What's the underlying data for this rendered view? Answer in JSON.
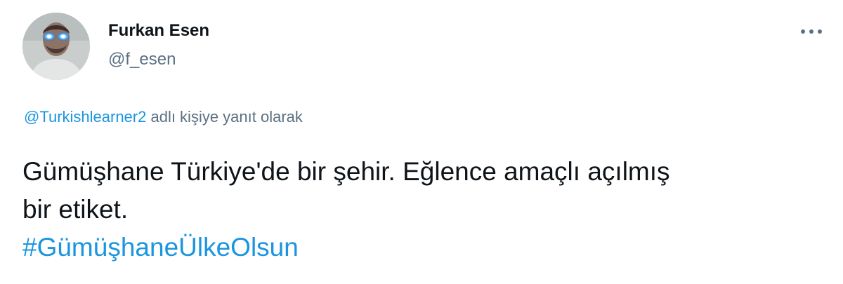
{
  "author": {
    "display_name": "Furkan Esen",
    "handle": "@f_esen",
    "avatar_icon": "avatar-photo"
  },
  "actions": {
    "more_icon": "more-horizontal-icon"
  },
  "reply_context": {
    "mention": "@Turkishlearner2",
    "suffix": " adlı kişiye yanıt olarak"
  },
  "body": {
    "line1": "Gümüşhane Türkiye'de bir şehir. Eğlence amaçlı açılmış",
    "line2": "bir etiket.",
    "hashtag": "#GümüşhaneÜlkeOlsun"
  },
  "colors": {
    "link": "#1b95e0",
    "secondary_text": "#5b7083",
    "primary_text": "#0f1419"
  }
}
